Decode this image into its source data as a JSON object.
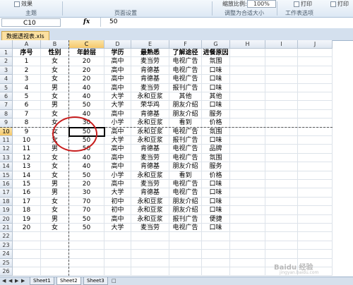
{
  "ribbon": {
    "top_items": [
      "效果",
      "缩放比例:",
      "100%",
      "打印",
      "打印"
    ],
    "groups": [
      "主题",
      "页面设置",
      "调整为合适大小",
      "工作表选项"
    ]
  },
  "formula_bar": {
    "name_box": "C10",
    "fx": "fx",
    "value": "50"
  },
  "file_tab": "数据透视表.xls",
  "columns": [
    "A",
    "B",
    "C",
    "D",
    "E",
    "F",
    "G",
    "H",
    "I",
    "J"
  ],
  "selected_column": "C",
  "selected_row": "10",
  "row_numbers": [
    "1",
    "2",
    "3",
    "4",
    "5",
    "6",
    "7",
    "8",
    "9",
    "10",
    "11",
    "12",
    "13",
    "14",
    "15",
    "16",
    "17",
    "18",
    "19",
    "20",
    "21",
    "22",
    "23",
    "24",
    "25",
    "26"
  ],
  "table": {
    "headers": [
      "序号",
      "性别",
      "年龄层",
      "学历",
      "最熟悉",
      "了解途径",
      "进餐原因"
    ],
    "rows": [
      [
        "1",
        "女",
        "20",
        "高中",
        "麦当劳",
        "电视广告",
        "氛围"
      ],
      [
        "2",
        "女",
        "20",
        "高中",
        "肯德基",
        "电视广告",
        "口味"
      ],
      [
        "3",
        "女",
        "20",
        "高中",
        "肯德基",
        "电视广告",
        "口味"
      ],
      [
        "4",
        "男",
        "40",
        "高中",
        "麦当劳",
        "报刊广告",
        "口味"
      ],
      [
        "5",
        "女",
        "40",
        "大学",
        "永和豆浆",
        "其他",
        "其他"
      ],
      [
        "6",
        "男",
        "50",
        "大学",
        "荣华鸡",
        "朋友介绍",
        "口味"
      ],
      [
        "7",
        "女",
        "40",
        "高中",
        "肯德基",
        "朋友介绍",
        "服务"
      ],
      [
        "8",
        "女",
        "30",
        "小学",
        "永和豆浆",
        "看到",
        "价格"
      ],
      [
        "9",
        "女",
        "50",
        "高中",
        "永和豆浆",
        "电视广告",
        "氛围"
      ],
      [
        "10",
        "女",
        "50",
        "大学",
        "永和豆浆",
        "报刊广告",
        "口味"
      ],
      [
        "11",
        "男",
        "50",
        "高中",
        "肯德基",
        "电视广告",
        "品牌"
      ],
      [
        "12",
        "女",
        "40",
        "高中",
        "麦当劳",
        "电视广告",
        "氛围"
      ],
      [
        "13",
        "女",
        "40",
        "高中",
        "肯德基",
        "朋友介绍",
        "服务"
      ],
      [
        "14",
        "女",
        "50",
        "小学",
        "永和豆浆",
        "看到",
        "价格"
      ],
      [
        "15",
        "男",
        "20",
        "高中",
        "麦当劳",
        "电视广告",
        "口味"
      ],
      [
        "16",
        "男",
        "30",
        "大学",
        "肯德基",
        "电视广告",
        "口味"
      ],
      [
        "17",
        "女",
        "70",
        "初中",
        "永和豆浆",
        "朋友介绍",
        "口味"
      ],
      [
        "18",
        "女",
        "70",
        "初中",
        "永和豆浆",
        "朋友介绍",
        "口味"
      ],
      [
        "19",
        "男",
        "50",
        "高中",
        "永和豆浆",
        "报刊广告",
        "便捷"
      ],
      [
        "20",
        "女",
        "50",
        "大学",
        "麦当劳",
        "电视广告",
        "口味"
      ]
    ]
  },
  "sheet_tabs": [
    "Sheet1",
    "Sheet2",
    "Sheet3"
  ],
  "active_sheet": "Sheet2",
  "watermark": {
    "main": "Baidu 经验",
    "sub": "jingyan.baidu.com"
  },
  "colors": {
    "selected_header": "#f5c86b",
    "highlight_circle": "#c81e1e",
    "tab": "#fbe0a0"
  }
}
